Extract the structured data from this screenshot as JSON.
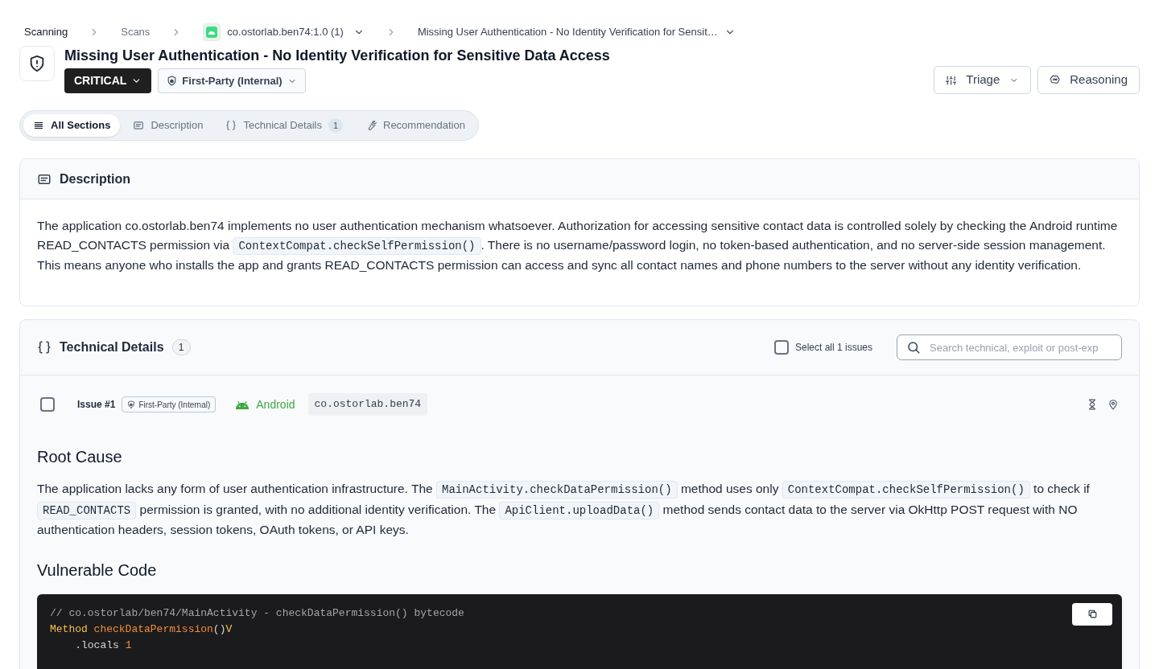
{
  "breadcrumbs": [
    {
      "label": "Scanning",
      "kind": "text"
    },
    {
      "label": "Scans",
      "kind": "link"
    },
    {
      "label": "co.ostorlab.ben74:1.0 (1)",
      "kind": "app"
    },
    {
      "label": "Missing User Authentication - No Identity Verification for Sensit…",
      "kind": "dropdown"
    }
  ],
  "title": "Missing User Authentication - No Identity Verification for Sensitive Data Access",
  "severity": "CRITICAL",
  "scope": "First-Party (Internal)",
  "actions": [
    {
      "label": "Triage",
      "kind": "triage"
    },
    {
      "label": "Reasoning",
      "kind": "reasoning"
    }
  ],
  "section_tabs": [
    {
      "label": "All Sections",
      "kind": "all",
      "selected": true
    },
    {
      "label": "Description",
      "kind": "description",
      "selected": false
    },
    {
      "label": "Technical Details",
      "kind": "technical",
      "count": "1",
      "selected": false
    },
    {
      "label": "Recommendation",
      "kind": "recommendation",
      "selected": false
    }
  ],
  "description": {
    "heading": "Description",
    "paragraph": [
      {
        "kind": "text",
        "text": "The application co.ostorlab.ben74 implements no user authentication mechanism whatsoever. Authorization for accessing sensitive contact data is controlled solely by checking the Android runtime READ_CONTACTS permission via "
      },
      {
        "kind": "code",
        "text": "ContextCompat.checkSelfPermission()"
      },
      {
        "kind": "text",
        "text": ". There is no username/password login, no token-based authentication, and no server-side session management. This means anyone who installs the app and grants READ_CONTACTS permission can access and sync all contact names and phone numbers to the server without any identity verification."
      }
    ]
  },
  "technical": {
    "heading": "Technical Details",
    "count": "1",
    "select_all": {
      "label": "Select all 1 issues",
      "checked": false
    },
    "search": {
      "placeholder": "Search technical, exploit or post-exp"
    },
    "issue": {
      "checked": false,
      "label": "Issue #1",
      "scope": "First-Party (Internal)",
      "platform": "Android",
      "package": "co.ostorlab.ben74",
      "root_cause": {
        "heading": "Root Cause",
        "paragraph": [
          {
            "kind": "text",
            "text": "The application lacks any form of user authentication infrastructure. The "
          },
          {
            "kind": "code",
            "text": "MainActivity.checkDataPermission()"
          },
          {
            "kind": "text",
            "text": " method uses only "
          },
          {
            "kind": "code",
            "text": "ContextCompat.checkSelfPermission()"
          },
          {
            "kind": "text",
            "text": " to check if "
          },
          {
            "kind": "code",
            "text": "READ_CONTACTS"
          },
          {
            "kind": "text",
            "text": " permission is granted, with no additional identity verification. The "
          },
          {
            "kind": "code",
            "text": "ApiClient.uploadData()"
          },
          {
            "kind": "text",
            "text": " method sends contact data to the server via OkHttp POST request with NO authentication headers, session tokens, OAuth tokens, or API keys."
          }
        ]
      },
      "vulnerable_code": {
        "heading": "Vulnerable Code",
        "lines": [
          [
            {
              "kind": "comment",
              "text": "// co.ostorlab/ben74/MainActivity - checkDataPermission() bytecode"
            }
          ],
          [
            {
              "kind": "keyword",
              "text": "Method "
            },
            {
              "kind": "function",
              "text": "checkDataPermission"
            },
            {
              "kind": "plain",
              "text": "()"
            },
            {
              "kind": "keyword",
              "text": "V"
            }
          ],
          [
            {
              "kind": "plain",
              "text": "    .locals "
            },
            {
              "kind": "number",
              "text": "1"
            }
          ]
        ]
      }
    }
  }
}
